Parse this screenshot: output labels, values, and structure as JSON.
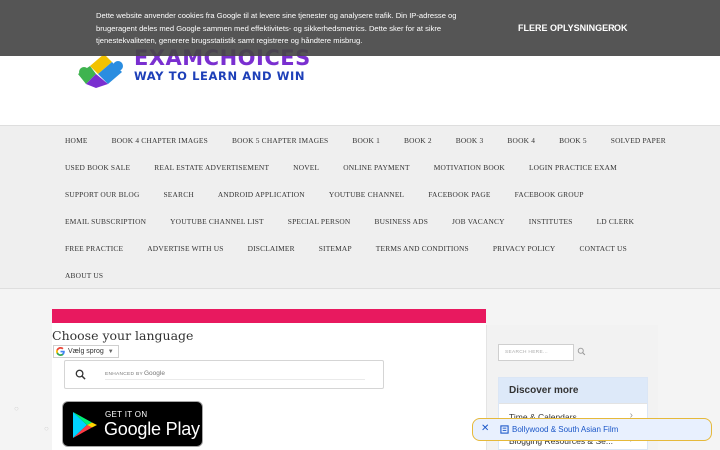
{
  "cookie_banner": {
    "text": "Dette website anvender cookies fra Google til at levere sine tjenester og analysere trafik. Din IP-adresse og brugeragent deles med Google sammen med effektivitets- og sikkerhedsmetrics. Dette sker for at sikre tjenestekvaliteten, generere brugsstatistik samt registrere og håndtere misbrug.",
    "more_label": "FLERE OPLYSNINGER",
    "ok_label": "OK"
  },
  "logo": {
    "brand": "EXAMCHOICES",
    "tagline": "WAY TO LEARN AND WIN"
  },
  "nav": {
    "rows": [
      [
        "HOME",
        "BOOK 4 CHAPTER IMAGES",
        "BOOK 5 CHAPTER IMAGES",
        "BOOK 1",
        "BOOK 2",
        "BOOK 3",
        "BOOK 4",
        "BOOK 5",
        "SOLVED PAPER"
      ],
      [
        "USED BOOK SALE",
        "REAL ESTATE ADVERTISEMENT",
        "NOVEL",
        "ONLINE PAYMENT",
        "MOTIVATION BOOK",
        "LOGIN PRACTICE EXAM"
      ],
      [
        "SUPPORT OUR BLOG",
        "SEARCH",
        "ANDROID APPLICATION",
        "YOUTUBE CHANNEL",
        "FACEBOOK PAGE",
        "FACEBOOK GROUP"
      ],
      [
        "EMAIL SUBSCRIPTION",
        "YOUTUBE CHANNEL LIST",
        "SPECIAL PERSON",
        "BUSINESS ADS",
        "JOB VACANCY",
        "INSTITUTES",
        "LD CLERK"
      ],
      [
        "FREE PRACTICE",
        "ADVERTISE WITH US",
        "DISCLAIMER",
        "SITEMAP",
        "TERMS AND CONDITIONS",
        "PRIVACY POLICY",
        "CONTACT US"
      ],
      [
        "ABOUT US"
      ]
    ]
  },
  "main": {
    "language_title": "Choose your language",
    "translate_label": "Vælg sprog",
    "translate_caret": "▼",
    "enhanced_by": "ENHANCED BY",
    "google_label": "Google",
    "play_get_it": "GET IT ON",
    "play_store": "Google Play"
  },
  "sidebar": {
    "search_placeholder": "SEARCH HERE...",
    "discover_title": "Discover more",
    "discover_items": [
      "Time & Calendars",
      "Blogging Resources & Se..."
    ]
  },
  "chip": {
    "close": "✕",
    "label": "Bollywood & South Asian Film"
  },
  "colors": {
    "accent_bar": "#e8195f",
    "cookie_bg": "#464646",
    "chip_border": "#e6b93a",
    "chip_text": "#1a56c8"
  }
}
